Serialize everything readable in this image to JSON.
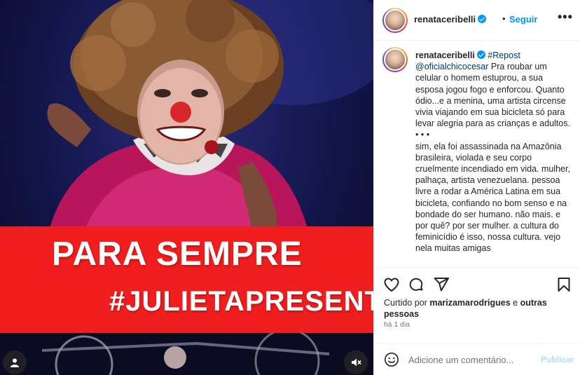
{
  "post": {
    "username": "renataceribelli",
    "dot": "•",
    "follow_label": "Seguir",
    "more_label": "•••"
  },
  "media": {
    "banner_line1": "PARA SEMPRE",
    "banner_line2": "#JULIETAPRESENTE",
    "banner_color": "#f01e1e"
  },
  "caption": {
    "username": "renataceribelli",
    "hashtag": "#Repost",
    "mention": "@oficialchicocesar",
    "paragraph1": "Pra roubar um celular o homem estuprou, a sua esposa jogou fogo e enforcou. Quanto ódio...e a menina, uma artista circense vivia viajando em sua bicicleta só para levar alegria para as crianças e adultos.",
    "dots": "• • •",
    "paragraph2": "sim, ela foi assassinada na Amazônia brasileira, violada e seu corpo cruelmente incendiado em vida. mulher, palhaça, artista venezuelana. pessoa livre a rodar a América Latina em sua bicicleta, confiando no bom senso e na bondade do ser humano. não mais. e por quê? por ser mulher. a cultura do feminicídio é isso, nossa cultura. vejo nela muitas amigas"
  },
  "likes": {
    "prefix": "Curtido por",
    "user": "marizamarodrigues",
    "suffix": "e",
    "others": "outras pessoas"
  },
  "time_label": "há 1 dia",
  "comment": {
    "placeholder": "Adicione um comentário...",
    "publish_label": "Publicar"
  },
  "icons": {
    "like": "heart-icon",
    "comment": "comment-icon",
    "share": "paper-plane-icon",
    "save": "bookmark-icon",
    "emoji": "smiley-icon",
    "tag": "user-tag-icon",
    "mute": "speaker-muted-icon",
    "verified": "verified-badge-icon"
  },
  "colors": {
    "link": "#0095f6",
    "mention": "#00376b",
    "publish_disabled": "#b3dbff"
  }
}
